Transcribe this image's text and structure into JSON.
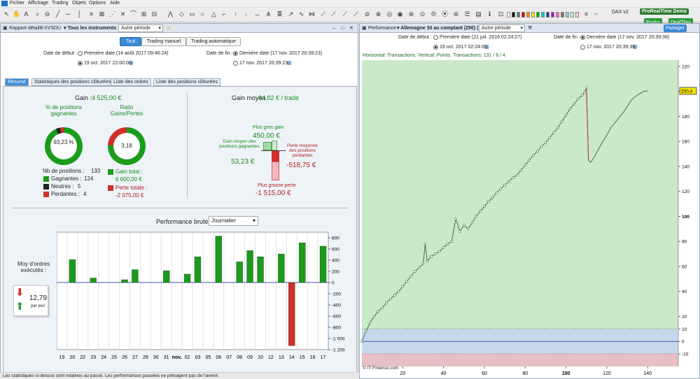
{
  "menu": [
    "Fichier",
    "Affichage",
    "Trading",
    "Objets",
    "Options",
    "Aide"
  ],
  "top_right": {
    "instrument": "DAX v2",
    "brand": "ProRealTime Demo",
    "push_label": "Push+",
    "dealthru_label": "DealThru"
  },
  "colors": {
    "gain": "#1a9c1a",
    "loss": "#d0302a",
    "neutral": "#222",
    "chart_bg": "#c9e9c9",
    "donut_bg": "#eaeaea"
  },
  "report": {
    "title": "Rapport détaillé",
    "instrument_code": "XVSDU",
    "scope": "Tous les instruments",
    "period": "Autre période",
    "mode_tabs": [
      "Tout",
      "Trading manuel",
      "Trading automatique"
    ],
    "start_label": "Date de début :",
    "start_first": "Première date (14 août 2017 09:46:24)",
    "start_date": "19 oct. 2017 22:00:00",
    "end_label": "Date de fin :",
    "end_last": "Dernière date (17 nov. 2017 20:39:23)",
    "end_date": "17 nov. 2017 20:39:23",
    "tabs": [
      "Résumé",
      "Statistiques des positions clôturées",
      "Liste des ordres",
      "Liste des positions clôturées"
    ],
    "gain_label": "Gain :",
    "gain_value": "4 525,00 €",
    "avg_gain_label": "Gain moyen :",
    "avg_gain_value": "34,02 € / trade",
    "pct_label": "% de positions gagnantes",
    "pct_value": "93,23 %",
    "pct_fraction": 0.9323,
    "ratio_label": "Ratio Gains/Pertes",
    "ratio_value": "3,18",
    "nb_label": "Nb de positions :",
    "nb_value": "133",
    "winners_label": "Gagnantes :",
    "winners_value": "124",
    "neutral_label": "Neutres :",
    "neutral_value": "5",
    "losers_label": "Perdantes :",
    "losers_value": "4",
    "total_gain_label": "Gain total :",
    "total_gain_value": "6 600,00 €",
    "total_loss_label": "Perte totale :",
    "total_loss_value": "-2 075,00 €",
    "best_label": "Plus gros gain",
    "best_value": "450,00 €",
    "avg_win_label": "Gain moyen des positions gagnantes",
    "avg_win_value": "53,23 €",
    "avg_loss_label": "Perte moyenne des positions perdantes",
    "avg_loss_value": "-518,75 €",
    "worst_label": "Plus grosse perte",
    "worst_value": "-1 515,00 €",
    "perf_title": "Performance brute",
    "perf_period": "Journalier",
    "moy_label": "Moy d'ordres exécutés :",
    "moy_value": "12,79",
    "moy_unit": "par jour",
    "footer": "Les statistiques ci-dessus sont relatives au passé. Les performances passées ne présagent pas de l'avenir."
  },
  "perf": {
    "title": "Performance",
    "instrument": "Allemagne 30 au comptant (25€) (-)",
    "period": "Autre période",
    "share": "Partager",
    "start_label": "Date de début :",
    "start_first": "Première date (21 juil. 2016 02:24:27)",
    "start_date": "19 oct. 2017 02:24:00",
    "end_label": "Date de fin :",
    "end_last": "Dernière date (17 nov. 2017 20:39:38)",
    "end_date": "17 nov. 2017 20:39:38",
    "info": "Horizontal: Transactions, Vertical: Points, Transactions: 131 / 6 / 4",
    "copyright": "© IT-Finance.com",
    "last_value": "200,4"
  },
  "chart_data": [
    {
      "type": "bar",
      "title": "Performance brute",
      "categories": [
        "19",
        "20",
        "22",
        "23",
        "24",
        "25",
        "26",
        "27",
        "29",
        "30",
        "31",
        "nov.",
        "02",
        "03",
        "05",
        "06",
        "07",
        "08",
        "09",
        "10",
        "12",
        "13",
        "14",
        "15",
        "16",
        "17"
      ],
      "values": [
        0,
        410,
        0,
        80,
        0,
        0,
        50,
        230,
        0,
        0,
        210,
        0,
        150,
        460,
        0,
        830,
        0,
        370,
        570,
        460,
        0,
        510,
        -1130,
        710,
        0,
        650
      ],
      "ylim": [
        -1200,
        900
      ],
      "yticks": [
        800,
        600,
        400,
        200,
        0,
        -200,
        -400,
        -600,
        -800,
        -1000,
        -1200
      ],
      "ytick_labels": [
        "800",
        "600",
        "400",
        "200",
        "0",
        "-200",
        "-400",
        "-600",
        "-800",
        "-1 000",
        "-1 200"
      ]
    },
    {
      "type": "line",
      "title": "",
      "x": [
        0,
        2,
        4,
        6,
        8,
        10,
        12,
        14,
        16,
        18,
        20,
        22,
        24,
        26,
        28,
        30,
        31,
        32,
        34,
        36,
        38,
        40,
        42,
        44,
        46,
        48,
        50,
        52,
        54,
        56,
        58,
        60,
        62,
        64,
        66,
        68,
        70,
        72,
        74,
        76,
        78,
        80,
        82,
        84,
        86,
        88,
        90,
        92,
        94,
        96,
        98,
        100,
        102,
        104,
        106,
        108,
        109,
        110,
        111,
        112,
        114,
        116,
        118,
        120,
        122,
        124,
        126,
        128,
        130,
        132,
        134,
        136,
        138,
        140
      ],
      "y": [
        0,
        8,
        15,
        20,
        24,
        27,
        31,
        34,
        37,
        40,
        44,
        48,
        52,
        56,
        59,
        62,
        78,
        64,
        68,
        70,
        72,
        75,
        78,
        80,
        98,
        88,
        93,
        90,
        95,
        100,
        104,
        108,
        112,
        115,
        119,
        122,
        125,
        128,
        131,
        133,
        137,
        141,
        145,
        149,
        152,
        156,
        159,
        163,
        167,
        171,
        176,
        181,
        186,
        190,
        194,
        197,
        199,
        203,
        145,
        143,
        148,
        154,
        160,
        165,
        171,
        175,
        179,
        183,
        188,
        193,
        196,
        198,
        200,
        200.4
      ],
      "xticks": [
        20,
        40,
        60,
        80,
        100,
        120,
        140
      ],
      "yticks": [
        220,
        200,
        180,
        160,
        140,
        120,
        100,
        80,
        60,
        40,
        20,
        10,
        0,
        -10
      ],
      "ylim": [
        -20,
        225
      ],
      "xlim": [
        0,
        155
      ]
    }
  ]
}
